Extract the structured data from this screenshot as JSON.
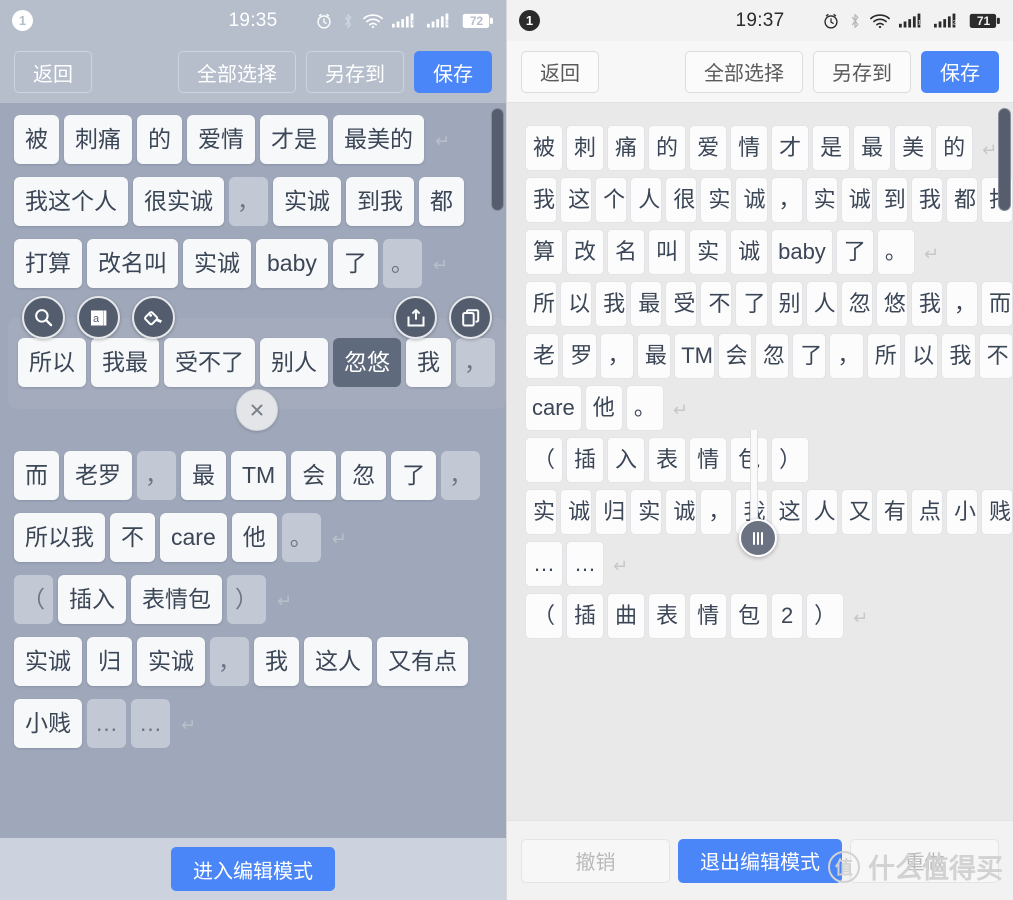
{
  "left_panel": {
    "status_bar": {
      "badge": "1",
      "clock": "19:35",
      "battery": "72",
      "icons": [
        "alarm-icon",
        "bluetooth-icon",
        "wifi-icon",
        "signal-1-icon",
        "signal-2-icon",
        "battery-icon"
      ]
    },
    "toolbar": {
      "back": "返回",
      "select_all": "全部选择",
      "save_as": "另存到",
      "save": "保存"
    },
    "lines": [
      {
        "chips": [
          {
            "t": "被"
          },
          {
            "t": "刺痛"
          },
          {
            "t": "的"
          },
          {
            "t": "爱情"
          },
          {
            "t": "才是"
          },
          {
            "t": "最美的"
          }
        ],
        "return": true
      },
      {
        "chips": [
          {
            "t": "我这个人"
          },
          {
            "t": "很实诚"
          },
          {
            "t": "，",
            "k": "punct"
          },
          {
            "t": "实诚"
          },
          {
            "t": "到我"
          },
          {
            "t": "都"
          }
        ],
        "return": false
      },
      {
        "chips": [
          {
            "t": "打算"
          },
          {
            "t": "改名叫"
          },
          {
            "t": "实诚"
          },
          {
            "t": "baby"
          },
          {
            "t": "了"
          },
          {
            "t": "。",
            "k": "punct"
          }
        ],
        "return": true
      },
      {
        "chips": [
          {
            "t": "所以"
          },
          {
            "t": "我最"
          },
          {
            "t": "受不了"
          },
          {
            "t": "别人"
          },
          {
            "t": "忽悠",
            "k": "sel"
          },
          {
            "t": "我"
          },
          {
            "t": "，",
            "k": "punct"
          }
        ],
        "return": false,
        "overlay": true
      },
      {
        "chips": [
          {
            "t": "而"
          },
          {
            "t": "老罗"
          },
          {
            "t": "，",
            "k": "punct"
          },
          {
            "t": "最"
          },
          {
            "t": "TM"
          },
          {
            "t": "会"
          },
          {
            "t": "忽"
          },
          {
            "t": "了"
          },
          {
            "t": "，",
            "k": "punct"
          }
        ],
        "return": false
      },
      {
        "chips": [
          {
            "t": "所以我"
          },
          {
            "t": "不"
          },
          {
            "t": "care"
          },
          {
            "t": "他"
          },
          {
            "t": "。",
            "k": "punct"
          }
        ],
        "return": true
      },
      {
        "chips": [
          {
            "t": "（",
            "k": "punct"
          },
          {
            "t": "插入"
          },
          {
            "t": "表情包"
          },
          {
            "t": "）",
            "k": "punct"
          }
        ],
        "return": true
      },
      {
        "chips": [
          {
            "t": "实诚"
          },
          {
            "t": "归"
          },
          {
            "t": "实诚"
          },
          {
            "t": "，",
            "k": "punct"
          },
          {
            "t": "我"
          },
          {
            "t": "这人"
          },
          {
            "t": "又有点"
          }
        ],
        "return": false
      },
      {
        "chips": [
          {
            "t": "小贱"
          },
          {
            "t": "…",
            "k": "punct"
          },
          {
            "t": "…",
            "k": "punct"
          }
        ],
        "return": true
      }
    ],
    "selection": {
      "actions": [
        "search-icon",
        "dictionary-icon",
        "highlight-icon",
        "share-icon",
        "copy-icon"
      ],
      "close": "close-icon"
    },
    "bottom": {
      "primary": "进入编辑模式"
    }
  },
  "right_panel": {
    "status_bar": {
      "badge": "1",
      "clock": "19:37",
      "battery": "71",
      "icons": [
        "alarm-icon",
        "bluetooth-icon",
        "wifi-icon",
        "signal-1-icon",
        "signal-2-icon",
        "battery-icon"
      ]
    },
    "toolbar": {
      "back": "返回",
      "select_all": "全部选择",
      "save_as": "另存到",
      "save": "保存"
    },
    "lines": [
      {
        "chips": [
          "被",
          "刺",
          "痛",
          "的",
          "爱",
          "情",
          "才",
          "是",
          "最",
          "美",
          "的"
        ],
        "return": true
      },
      {
        "chips": [
          "我",
          "这",
          "个",
          "人",
          "很",
          "实",
          "诚",
          "，",
          "实",
          "诚",
          "到",
          "我",
          "都",
          "打"
        ],
        "return": false
      },
      {
        "chips": [
          "算",
          "改",
          "名",
          "叫",
          "实",
          "诚",
          "baby",
          "了",
          "。"
        ],
        "return": true
      },
      {
        "chips": [
          "所",
          "以",
          "我",
          "最",
          "受",
          "不",
          "了",
          "别",
          "人",
          "忽",
          "悠",
          "我",
          "，",
          "而"
        ],
        "return": false
      },
      {
        "chips": [
          "老",
          "罗",
          "，",
          "最",
          "TM",
          "会",
          "忽",
          "了",
          "，",
          "所",
          "以",
          "我",
          "不"
        ],
        "return": false
      },
      {
        "chips": [
          "care",
          "他",
          "。"
        ],
        "return": true
      },
      {
        "chips": [
          "（",
          "插",
          "入",
          "表",
          "情",
          "包",
          "）"
        ],
        "return": false
      },
      {
        "chips": [
          "实",
          "诚",
          "归",
          "实",
          "诚",
          "，",
          "我",
          "这",
          "人",
          "又",
          "有",
          "点",
          "小",
          "贱"
        ],
        "return": false
      },
      {
        "chips": [
          "…",
          "…"
        ],
        "return": true
      },
      {
        "chips": [
          "（",
          "插",
          "曲",
          "表",
          "情",
          "包",
          "2",
          "）"
        ],
        "return": true
      }
    ],
    "bottom": {
      "undo": "撤销",
      "primary": "退出编辑模式",
      "redo": "重做"
    },
    "watermark": {
      "mark": "值",
      "text": "什么值得买"
    }
  }
}
